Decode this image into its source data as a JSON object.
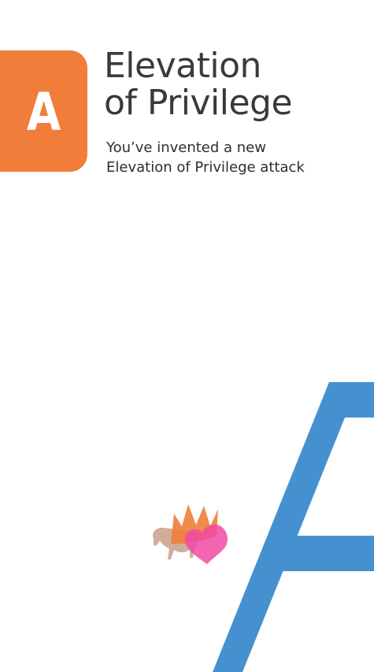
{
  "card": {
    "rank": "A",
    "title_lines": [
      "Elevation",
      "of Privilege"
    ],
    "description_lines": [
      "You’ve invented a new",
      "Elevation of Privilege attack"
    ],
    "big_letter": "A"
  },
  "colors": {
    "badge": "#f07d3a",
    "big_letter": "#4591d0",
    "title_text": "#3a3a3a",
    "logo_crown": "#f07d3a",
    "logo_heart": "#ef4aa3",
    "logo_animal": "#c99f8a"
  },
  "icons": {
    "logo": "crown-heart-creature-logo",
    "big_letter": "large-card-letter-a"
  }
}
